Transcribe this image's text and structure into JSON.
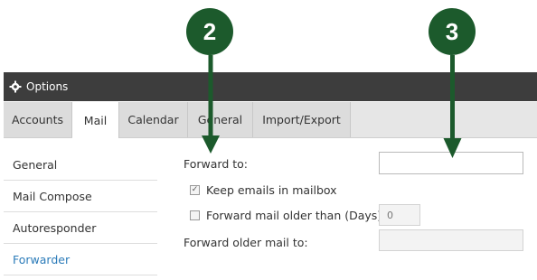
{
  "callouts": [
    "2",
    "3"
  ],
  "window": {
    "title": "Options",
    "icon": "gear-icon"
  },
  "tabs": [
    {
      "label": "Accounts",
      "active": false
    },
    {
      "label": "Mail",
      "active": true
    },
    {
      "label": "Calendar",
      "active": false
    },
    {
      "label": "General",
      "active": false
    },
    {
      "label": "Import/Export",
      "active": false
    }
  ],
  "sidebar": [
    {
      "label": "General"
    },
    {
      "label": "Mail Compose"
    },
    {
      "label": "Autoresponder"
    },
    {
      "label": "Forwarder",
      "active": true
    }
  ],
  "form": {
    "forward_to_label": "Forward to:",
    "forward_to_value": "",
    "keep_label": "Keep emails in mailbox",
    "keep_checked": true,
    "older_label": "Forward mail older than (Days):",
    "older_checked": false,
    "days_value": "0",
    "older_to_label": "Forward older mail to:",
    "older_to_value": ""
  },
  "colors": {
    "callout": "#1c5a2c",
    "titlebar": "#3d3d3d",
    "active_link": "#2b7bb9"
  }
}
